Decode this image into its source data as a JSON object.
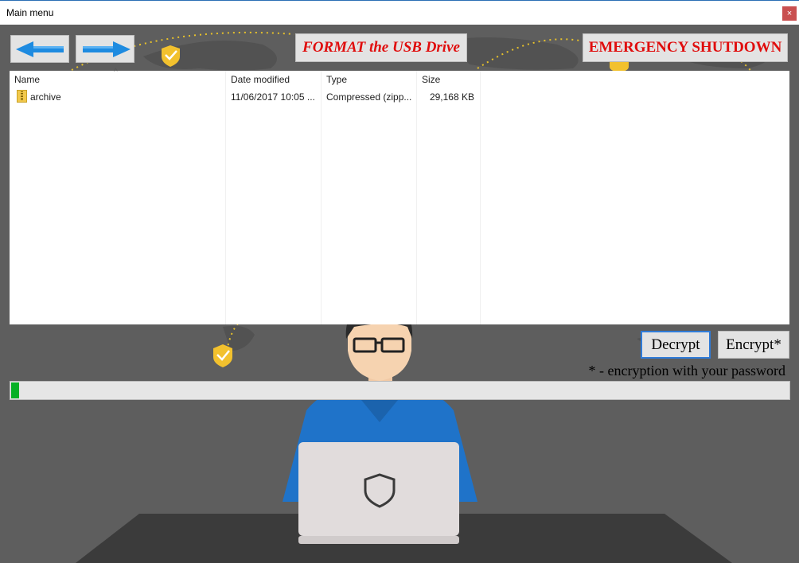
{
  "window": {
    "title": "Main menu",
    "close_glyph": "×"
  },
  "toolbar": {
    "back_icon": "arrow-left-icon",
    "forward_icon": "arrow-right-icon",
    "format_label": "FORMAT the USB Drive",
    "shutdown_label": "EMERGENCY SHUTDOWN"
  },
  "filelist": {
    "columns": [
      "Name",
      "Date modified",
      "Type",
      "Size"
    ],
    "sort_indicator": "^",
    "rows": [
      {
        "name": "archive",
        "date": "11/06/2017 10:05 ...",
        "type": "Compressed (zipp...",
        "size": "29,168 KB",
        "icon": "zip-folder-icon"
      }
    ]
  },
  "actions": {
    "decrypt_label": "Decrypt",
    "encrypt_label": "Encrypt*",
    "note": "* - encryption with your password"
  },
  "progress": {
    "value_fraction": 0.01
  },
  "colors": {
    "accent_red": "#e00d0d",
    "progress_green": "#06b025",
    "focus_blue": "#2f7bd8",
    "background_gray": "#5e5e5e"
  }
}
